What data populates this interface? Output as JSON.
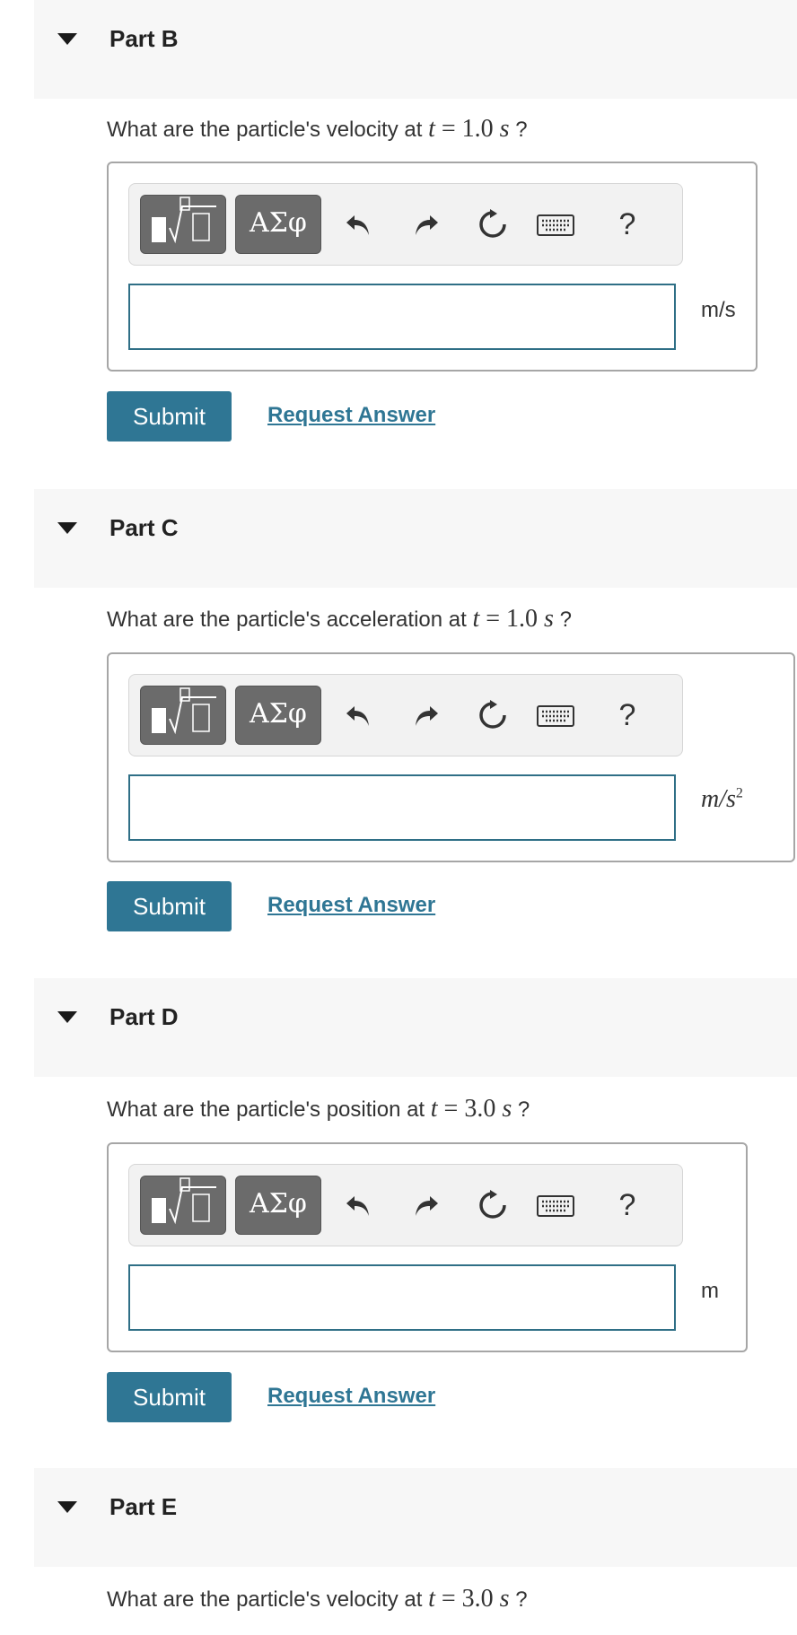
{
  "colors": {
    "header_bg": "#f7f7f7",
    "accent": "#2f7694",
    "input_border": "#2f6f86"
  },
  "icons": {
    "collapse": "caret-down-icon",
    "templates": "templates-icon",
    "greek": "greek-symbols-icon",
    "undo": "undo-icon",
    "redo": "redo-icon",
    "reset": "reset-icon",
    "keyboard": "keyboard-icon"
  },
  "toolbar": {
    "greek_label": "ΑΣφ",
    "help_label": "?"
  },
  "parts": [
    {
      "title": "Part B",
      "question_prefix": "What are the particle's velocity at ",
      "var": "t",
      "eq": " = 1.0 ",
      "unit_var": "s",
      "question_suffix": " ?",
      "unit": "m/s",
      "submit": "Submit",
      "request": "Request Answer"
    },
    {
      "title": "Part C",
      "question_prefix": "What are the particle's acceleration at ",
      "var": "t",
      "eq": " = 1.0 ",
      "unit_var": "s",
      "question_suffix": " ?",
      "unit_base": "m/s",
      "unit_exp": "2",
      "submit": "Submit",
      "request": "Request Answer"
    },
    {
      "title": "Part D",
      "question_prefix": "What are the particle's position at ",
      "var": "t",
      "eq": " = 3.0 ",
      "unit_var": "s",
      "question_suffix": " ?",
      "unit": "m",
      "submit": "Submit",
      "request": "Request Answer"
    },
    {
      "title": "Part E",
      "question_prefix": "What are the particle's velocity at ",
      "var": "t",
      "eq": " = 3.0 ",
      "unit_var": "s",
      "question_suffix": " ?"
    }
  ]
}
